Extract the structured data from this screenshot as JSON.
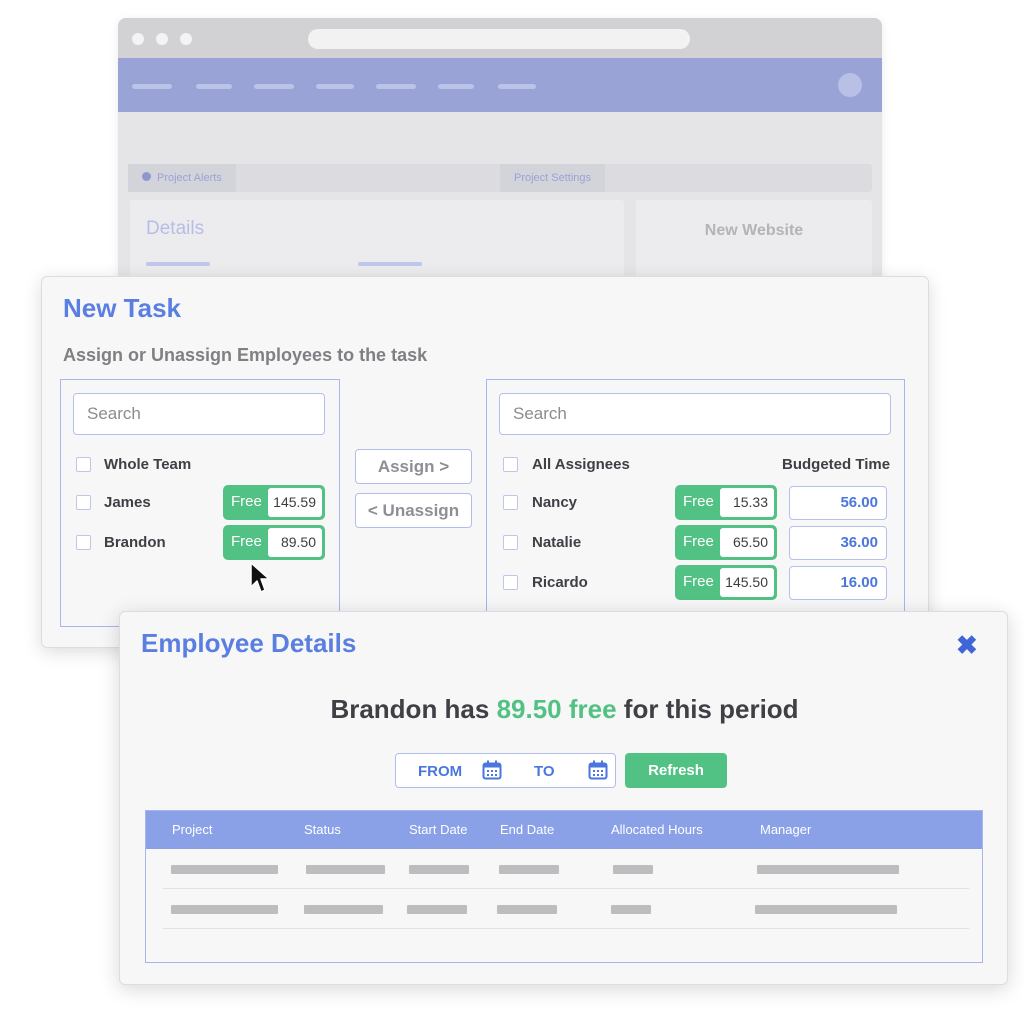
{
  "background": {
    "tabs": [
      {
        "label": "Project Alerts",
        "icon": "bell-icon"
      },
      {
        "label": "Project Settings"
      }
    ],
    "details_label": "Details",
    "project_name": "New Website"
  },
  "new_task": {
    "title": "New Task",
    "subtitle": "Assign or Unassign Employees to the task",
    "left_panel": {
      "search_placeholder": "Search",
      "select_all_label": "Whole Team",
      "employees": [
        {
          "name": "James",
          "free_label": "Free",
          "free_value": "145.59"
        },
        {
          "name": "Brandon",
          "free_label": "Free",
          "free_value": "89.50"
        }
      ]
    },
    "assign_label": "Assign >",
    "unassign_label": "< Unassign",
    "right_panel": {
      "search_placeholder": "Search",
      "select_all_label": "All Assignees",
      "budget_header": "Budgeted Time",
      "assignees": [
        {
          "name": "Nancy",
          "free_label": "Free",
          "free_value": "15.33",
          "budgeted": "56.00"
        },
        {
          "name": "Natalie",
          "free_label": "Free",
          "free_value": "65.50",
          "budgeted": "36.00"
        },
        {
          "name": "Ricardo",
          "free_label": "Free",
          "free_value": "145.50",
          "budgeted": "16.00"
        }
      ]
    }
  },
  "employee_details": {
    "title": "Employee Details",
    "close_icon": "close-icon",
    "headline": {
      "prefix": "Brandon has ",
      "free_amount": "89.50 free",
      "suffix": " for this period"
    },
    "from_label": "FROM",
    "to_label": "TO",
    "refresh_label": "Refresh",
    "table_headers": [
      "Project",
      "Status",
      "Start Date",
      "End Date",
      "Allocated Hours",
      "Manager"
    ]
  },
  "colors": {
    "accent_blue": "#5a7fe0",
    "free_green": "#52c184",
    "table_header_blue": "#8aa1e8"
  }
}
